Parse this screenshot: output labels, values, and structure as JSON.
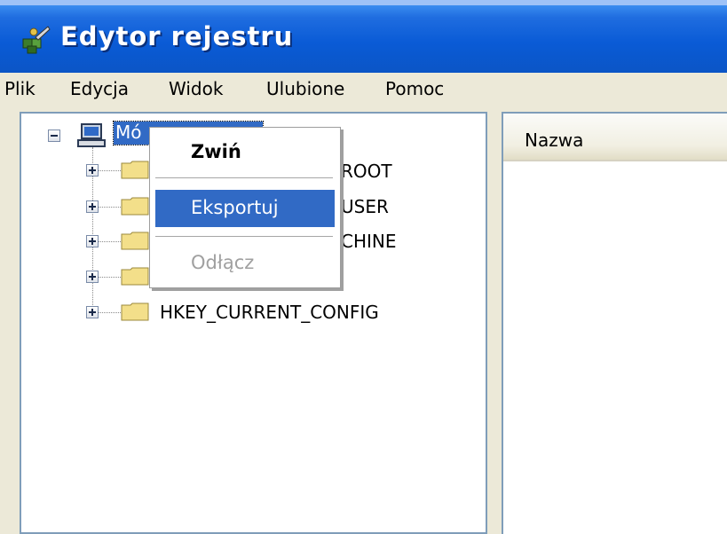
{
  "window": {
    "title": "Edytor rejestru"
  },
  "menubar": {
    "items": [
      "Plik",
      "Edycja",
      "Widok",
      "Ulubione",
      "Pomoc"
    ]
  },
  "tree": {
    "root_label": "Mó",
    "keys": [
      {
        "visible_text": "ROOT"
      },
      {
        "visible_text": "USER"
      },
      {
        "visible_text": "CHINE"
      },
      {
        "visible_text": ""
      },
      {
        "visible_text": "HKEY_CURRENT_CONFIG"
      }
    ]
  },
  "list": {
    "columns": [
      "Nazwa"
    ]
  },
  "context_menu": {
    "items": [
      {
        "label": "Zwiń",
        "style": "bold"
      },
      {
        "label": "Eksportuj",
        "style": "highlighted"
      },
      {
        "label": "Odłącz",
        "style": "disabled"
      }
    ]
  },
  "colors": {
    "titlebar": "#0a5bd6",
    "selection": "#316ac5",
    "disabled_text": "#a0a0a0",
    "menubar": "#ece9d8"
  }
}
